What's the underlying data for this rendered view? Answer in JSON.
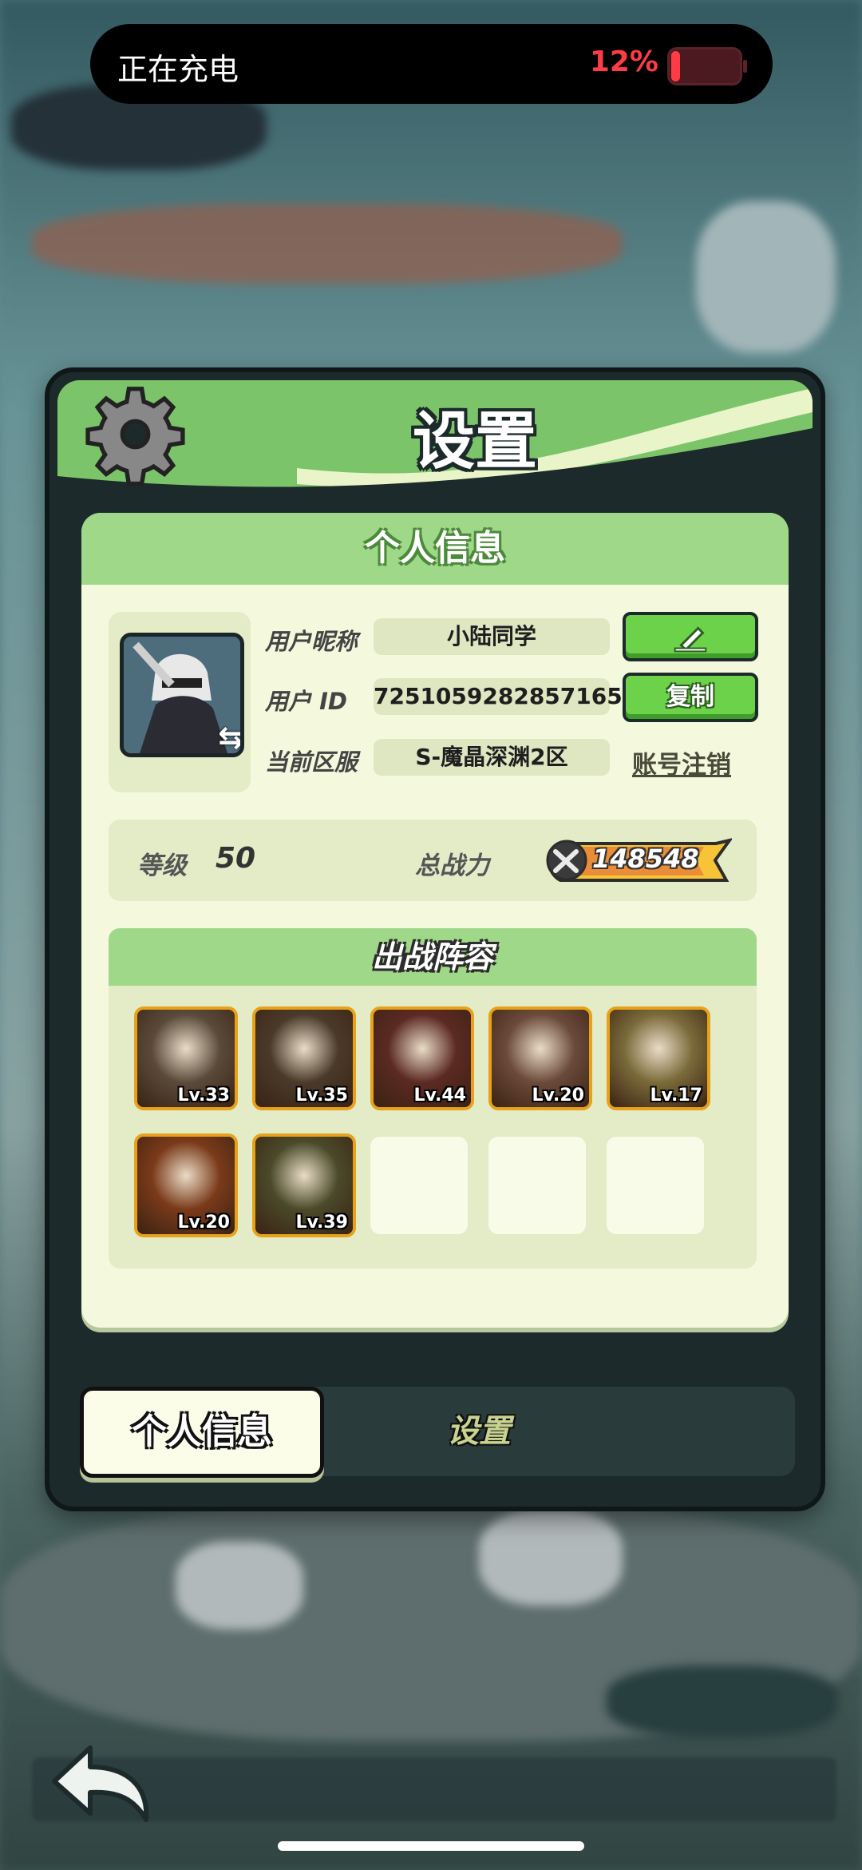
{
  "status": {
    "charging_text": "正在充电",
    "battery_percent": "12%",
    "battery_level": 0.12
  },
  "panel": {
    "title": "设置",
    "section_title": "个人信息"
  },
  "profile": {
    "nickname_label": "用户昵称",
    "nickname": "小陆同学",
    "id_label": "用户 ID",
    "id": "7251059282857165",
    "server_label": "当前区服",
    "server": "S-魔晶深渊2区",
    "copy_label": "复制",
    "cancel_account_label": "账号注销"
  },
  "stats": {
    "level_label": "等级",
    "level": "50",
    "power_label": "总战力",
    "power": "148548"
  },
  "lineup": {
    "title": "出战阵容",
    "heroes": [
      {
        "level": "Lv.33",
        "color": "#5a4a3a"
      },
      {
        "level": "Lv.35",
        "color": "#4a3a2a"
      },
      {
        "level": "Lv.44",
        "color": "#5b2a22"
      },
      {
        "level": "Lv.20",
        "color": "#6b4a3a"
      },
      {
        "level": "Lv.17",
        "color": "#7a6a3a"
      },
      {
        "level": "Lv.20",
        "color": "#7a3a1a"
      },
      {
        "level": "Lv.39",
        "color": "#4a4a2a"
      }
    ],
    "empty_slots": 3
  },
  "tabs": {
    "active": "个人信息",
    "inactive": "设置"
  },
  "colors": {
    "header_green": "#7cc46a",
    "card_bg": "#f4f9dd",
    "button_green": "#6cd24a",
    "hero_border": "#e7a21a",
    "battery_red": "#ff3b46"
  }
}
